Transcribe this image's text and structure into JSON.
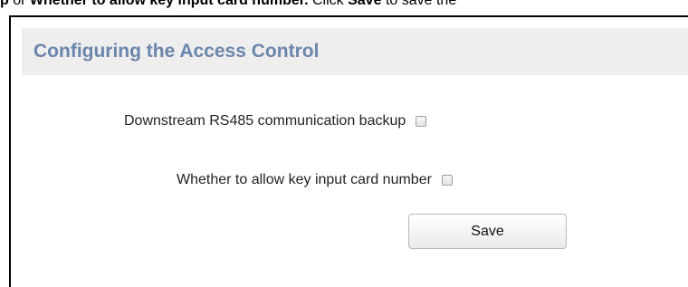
{
  "doc_text": {
    "lead_bold": "p",
    "or": "or",
    "bold_option": "Whether to allow key input card number.",
    "click": "Click",
    "save_word": "Save",
    "tail": "to save the"
  },
  "panel": {
    "title": "Configuring the Access Control",
    "options": [
      {
        "label": "Downstream RS485 communication backup",
        "checked": false
      },
      {
        "label": "Whether to allow key input card number",
        "checked": false
      }
    ],
    "save_label": "Save"
  }
}
